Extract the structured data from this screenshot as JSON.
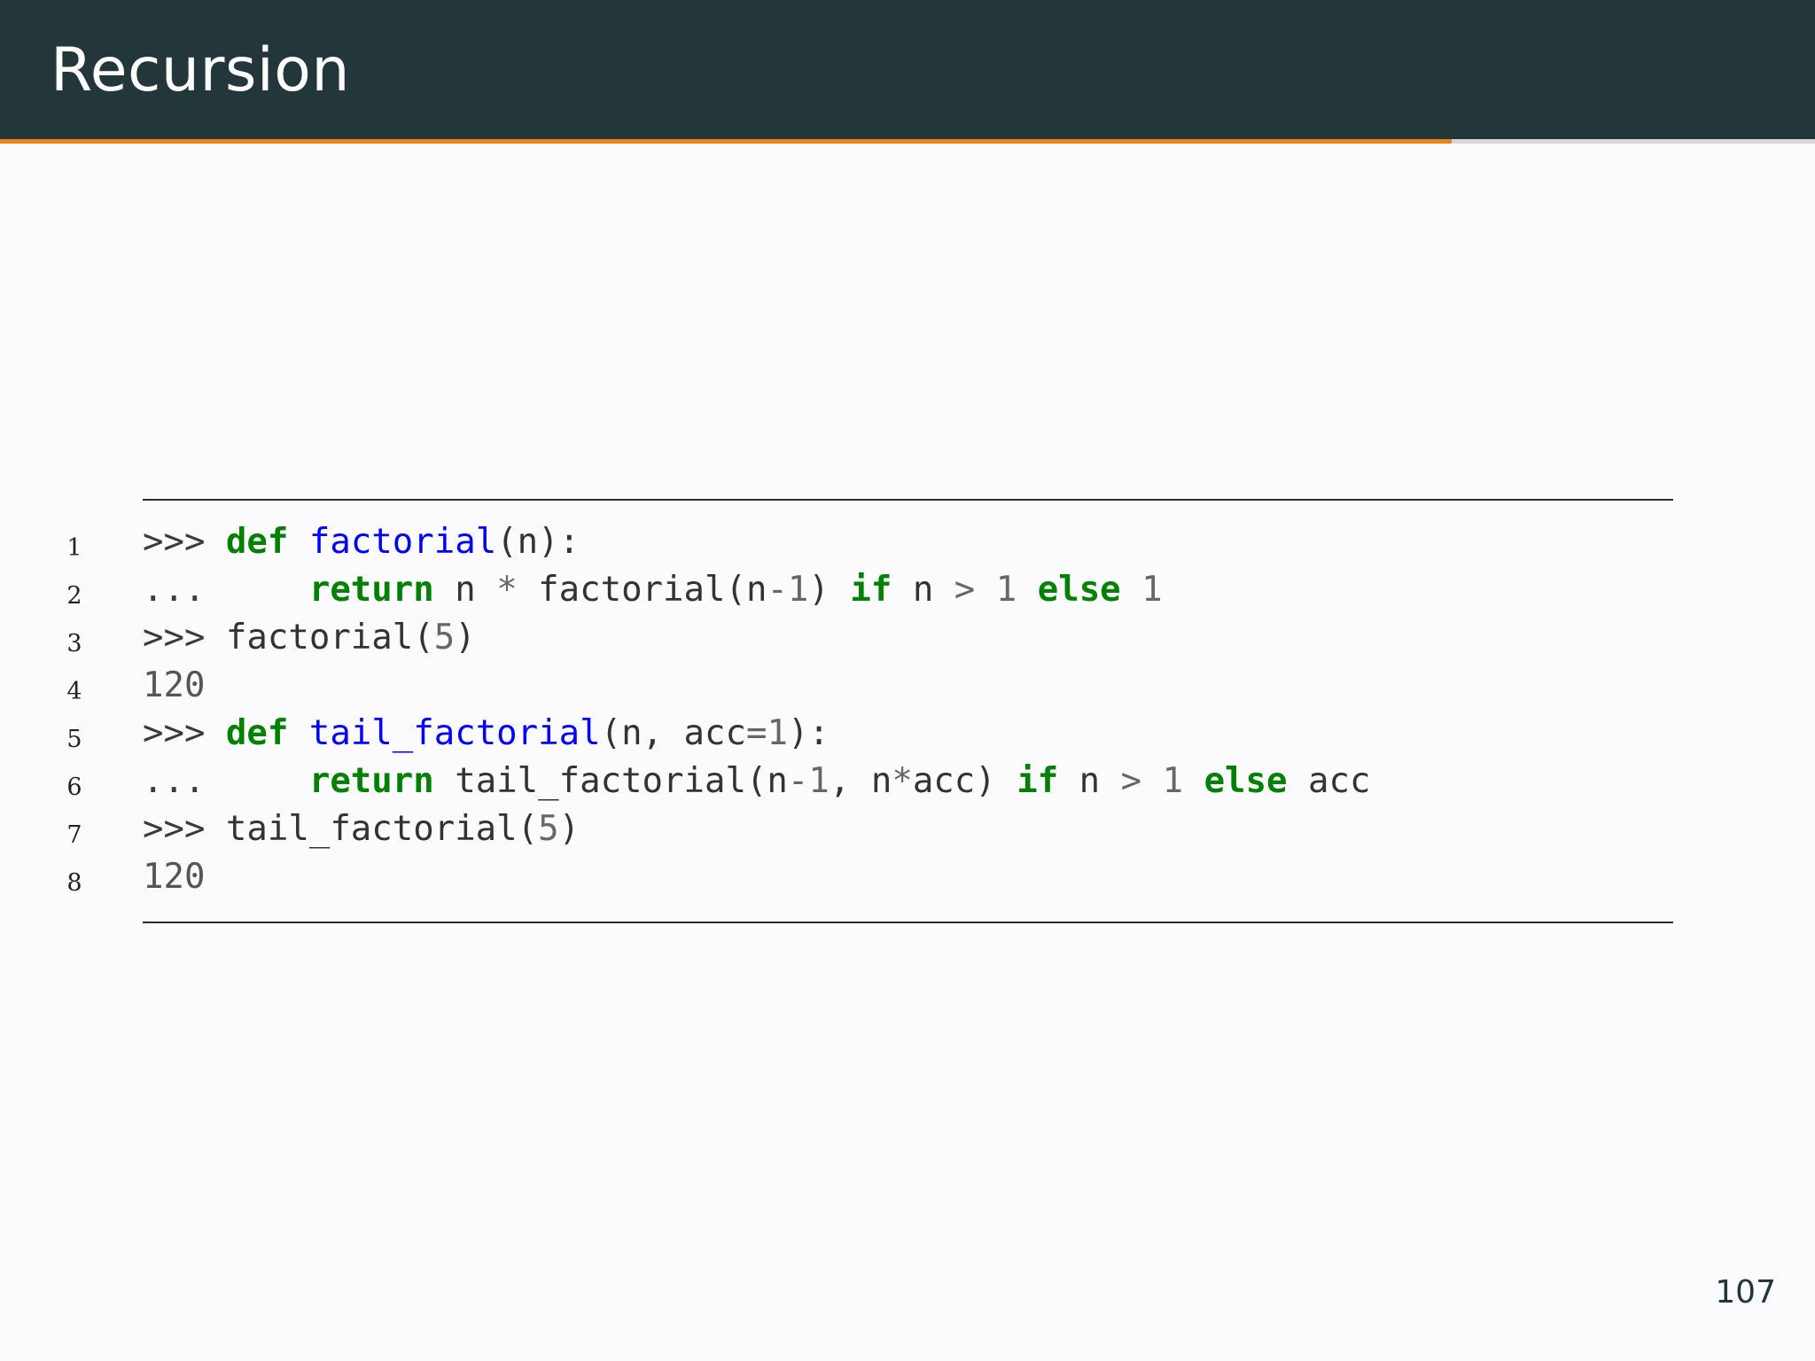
{
  "slide": {
    "title": "Recursion",
    "page_number": "107",
    "progress": 0.8
  },
  "colors": {
    "header_background": "#23373b",
    "progress_accent": "#eb811b",
    "progress_track": "#d6d6d6",
    "slide_background": "#fbfafc",
    "keyword": "#008000",
    "function_name": "#0000ff",
    "number": "#666666"
  },
  "code": {
    "lines": [
      {
        "number": "1",
        "tokens": [
          {
            "text": ">>> ",
            "kind": "prompt"
          },
          {
            "text": "def",
            "kind": "kw"
          },
          {
            "text": " ",
            "kind": "plain"
          },
          {
            "text": "factorial",
            "kind": "fn"
          },
          {
            "text": "(n):",
            "kind": "plain"
          }
        ]
      },
      {
        "number": "2",
        "tokens": [
          {
            "text": "...     ",
            "kind": "prompt"
          },
          {
            "text": "return",
            "kind": "kw"
          },
          {
            "text": " n ",
            "kind": "plain"
          },
          {
            "text": "*",
            "kind": "op"
          },
          {
            "text": " factorial(n",
            "kind": "plain"
          },
          {
            "text": "-",
            "kind": "op"
          },
          {
            "text": "1",
            "kind": "num"
          },
          {
            "text": ") ",
            "kind": "plain"
          },
          {
            "text": "if",
            "kind": "kw"
          },
          {
            "text": " n ",
            "kind": "plain"
          },
          {
            "text": ">",
            "kind": "op"
          },
          {
            "text": " ",
            "kind": "plain"
          },
          {
            "text": "1",
            "kind": "num"
          },
          {
            "text": " ",
            "kind": "plain"
          },
          {
            "text": "else",
            "kind": "kw"
          },
          {
            "text": " ",
            "kind": "plain"
          },
          {
            "text": "1",
            "kind": "num"
          }
        ]
      },
      {
        "number": "3",
        "tokens": [
          {
            "text": ">>> ",
            "kind": "prompt"
          },
          {
            "text": "factorial(",
            "kind": "plain"
          },
          {
            "text": "5",
            "kind": "num"
          },
          {
            "text": ")",
            "kind": "plain"
          }
        ]
      },
      {
        "number": "4",
        "tokens": [
          {
            "text": "120",
            "kind": "out"
          }
        ]
      },
      {
        "number": "5",
        "tokens": [
          {
            "text": ">>> ",
            "kind": "prompt"
          },
          {
            "text": "def",
            "kind": "kw"
          },
          {
            "text": " ",
            "kind": "plain"
          },
          {
            "text": "tail_factorial",
            "kind": "fn"
          },
          {
            "text": "(n, acc",
            "kind": "plain"
          },
          {
            "text": "=",
            "kind": "op"
          },
          {
            "text": "1",
            "kind": "num"
          },
          {
            "text": "):",
            "kind": "plain"
          }
        ]
      },
      {
        "number": "6",
        "tokens": [
          {
            "text": "...     ",
            "kind": "prompt"
          },
          {
            "text": "return",
            "kind": "kw"
          },
          {
            "text": " tail_factorial(n",
            "kind": "plain"
          },
          {
            "text": "-",
            "kind": "op"
          },
          {
            "text": "1",
            "kind": "num"
          },
          {
            "text": ", n",
            "kind": "plain"
          },
          {
            "text": "*",
            "kind": "op"
          },
          {
            "text": "acc) ",
            "kind": "plain"
          },
          {
            "text": "if",
            "kind": "kw"
          },
          {
            "text": " n ",
            "kind": "plain"
          },
          {
            "text": ">",
            "kind": "op"
          },
          {
            "text": " ",
            "kind": "plain"
          },
          {
            "text": "1",
            "kind": "num"
          },
          {
            "text": " ",
            "kind": "plain"
          },
          {
            "text": "else",
            "kind": "kw"
          },
          {
            "text": " acc",
            "kind": "plain"
          }
        ]
      },
      {
        "number": "7",
        "tokens": [
          {
            "text": ">>> ",
            "kind": "prompt"
          },
          {
            "text": "tail_factorial(",
            "kind": "plain"
          },
          {
            "text": "5",
            "kind": "num"
          },
          {
            "text": ")",
            "kind": "plain"
          }
        ]
      },
      {
        "number": "8",
        "tokens": [
          {
            "text": "120",
            "kind": "out"
          }
        ]
      }
    ]
  }
}
